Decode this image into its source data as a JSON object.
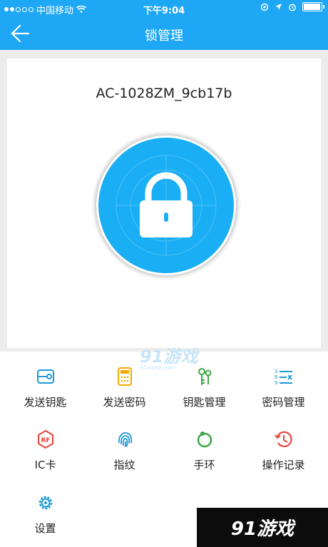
{
  "status_bar": {
    "carrier": "中国移动",
    "time": "下午9:04",
    "signal_bars_filled": 2,
    "battery_level": 0.9
  },
  "nav": {
    "title": "锁管理",
    "back_icon": "back-arrow-icon"
  },
  "device": {
    "name": "AC-1028ZM_9cb17b",
    "lock_icon": "lock-icon"
  },
  "menu": [
    {
      "label": "发送钥匙",
      "icon": "send-key-icon",
      "color": "#1c9ad6"
    },
    {
      "label": "发送密码",
      "icon": "send-password-icon",
      "color": "#f2a900"
    },
    {
      "label": "钥匙管理",
      "icon": "key-management-icon",
      "color": "#3aa744"
    },
    {
      "label": "密码管理",
      "icon": "password-management-icon",
      "color": "#1c9ad6"
    },
    {
      "label": "IC卡",
      "icon": "ic-card-icon",
      "color": "#e8453c"
    },
    {
      "label": "指纹",
      "icon": "fingerprint-icon",
      "color": "#1c9ad6"
    },
    {
      "label": "手环",
      "icon": "wristband-icon",
      "color": "#3aa744"
    },
    {
      "label": "操作记录",
      "icon": "operation-log-icon",
      "color": "#e8453c"
    },
    {
      "label": "设置",
      "icon": "settings-icon",
      "color": "#1c9ad6"
    }
  ],
  "watermarks": {
    "center": "91游戏",
    "center_sub": "91danji.com",
    "corner": "91游戏"
  },
  "colors": {
    "primary": "#1ea7f5",
    "lock_circle": "#1aaef4"
  }
}
